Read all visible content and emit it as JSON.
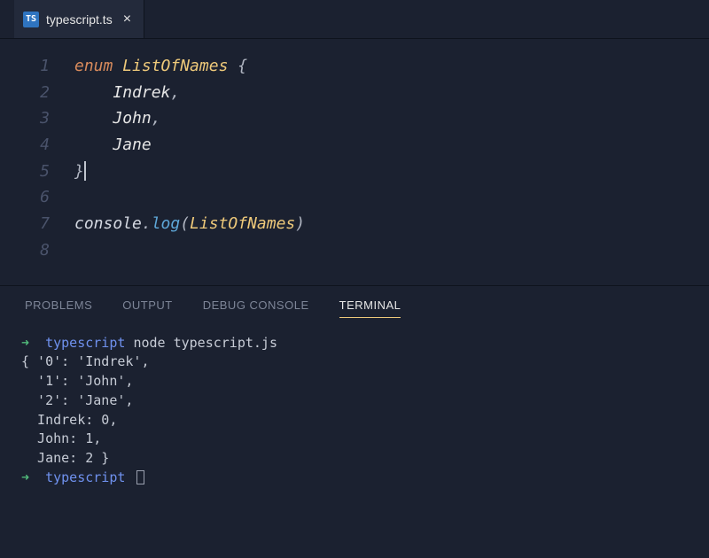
{
  "tab": {
    "icon_text": "TS",
    "filename": "typescript.ts",
    "close_glyph": "×"
  },
  "editor": {
    "lines": [
      {
        "n": "1",
        "tokens": [
          {
            "cls": "kw",
            "t": "enum"
          },
          {
            "cls": "",
            "t": " "
          },
          {
            "cls": "type",
            "t": "ListOfNames"
          },
          {
            "cls": "",
            "t": " "
          },
          {
            "cls": "punc",
            "t": "{"
          }
        ]
      },
      {
        "n": "2",
        "tokens": [
          {
            "cls": "",
            "t": "    "
          },
          {
            "cls": "str",
            "t": "Indrek"
          },
          {
            "cls": "punc",
            "t": ","
          }
        ]
      },
      {
        "n": "3",
        "tokens": [
          {
            "cls": "",
            "t": "    "
          },
          {
            "cls": "str",
            "t": "John"
          },
          {
            "cls": "punc",
            "t": ","
          }
        ]
      },
      {
        "n": "4",
        "tokens": [
          {
            "cls": "",
            "t": "    "
          },
          {
            "cls": "str",
            "t": "Jane"
          }
        ]
      },
      {
        "n": "5",
        "tokens": [
          {
            "cls": "punc",
            "t": "}"
          },
          {
            "cls": "cursor",
            "t": ""
          }
        ]
      },
      {
        "n": "6",
        "tokens": [
          {
            "cls": "",
            "t": ""
          }
        ]
      },
      {
        "n": "7",
        "tokens": [
          {
            "cls": "obj",
            "t": "console"
          },
          {
            "cls": "punc",
            "t": "."
          },
          {
            "cls": "fn",
            "t": "log"
          },
          {
            "cls": "punc",
            "t": "("
          },
          {
            "cls": "type",
            "t": "ListOfNames"
          },
          {
            "cls": "punc",
            "t": ")"
          }
        ]
      },
      {
        "n": "8",
        "tokens": [
          {
            "cls": "",
            "t": ""
          }
        ]
      }
    ]
  },
  "panel": {
    "tabs": {
      "problems": "PROBLEMS",
      "output": "OUTPUT",
      "debug": "DEBUG CONSOLE",
      "terminal": "TERMINAL"
    },
    "active": "terminal"
  },
  "terminal": {
    "prompt_arrow": "➜",
    "prompt_ctx": "typescript",
    "command": "node typescript.js",
    "output": [
      "{ '0': 'Indrek',",
      "  '1': 'John',",
      "  '2': 'Jane',",
      "  Indrek: 0,",
      "  John: 1,",
      "  Jane: 2 }"
    ]
  }
}
